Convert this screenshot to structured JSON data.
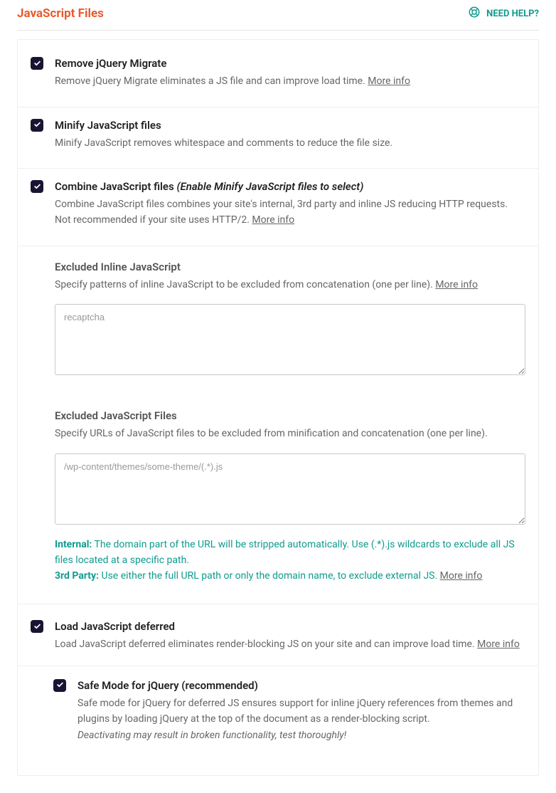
{
  "header": {
    "title": "JavaScript Files",
    "help_label": "NEED HELP?"
  },
  "options": {
    "remove_migrate": {
      "title": "Remove jQuery Migrate",
      "desc": "Remove jQuery Migrate eliminates a JS file and can improve load time. ",
      "more": "More info"
    },
    "minify": {
      "title": "Minify JavaScript files",
      "desc": "Minify JavaScript removes whitespace and comments to reduce the file size."
    },
    "combine": {
      "title": "Combine JavaScript files ",
      "hint": "(Enable Minify JavaScript files to select)",
      "desc": "Combine JavaScript files combines your site's internal, 3rd party and inline JS reducing HTTP requests. Not recommended if your site uses HTTP/2. ",
      "more": "More info"
    },
    "excluded_inline": {
      "title": "Excluded Inline JavaScript",
      "desc": "Specify patterns of inline JavaScript to be excluded from concatenation (one per line). ",
      "more": "More info",
      "placeholder": "recaptcha"
    },
    "excluded_files": {
      "title": "Excluded JavaScript Files",
      "desc": "Specify URLs of JavaScript files to be excluded from minification and concatenation (one per line).",
      "placeholder": "/wp-content/themes/some-theme/(.*).js",
      "note_internal_label": "Internal:",
      "note_internal_text": " The domain part of the URL will be stripped automatically. Use (.*).js wildcards to exclude all JS files located at a specific path.",
      "note_3rd_label": "3rd Party:",
      "note_3rd_text": " Use either the full URL path or only the domain name, to exclude external JS. ",
      "more": "More info"
    },
    "deferred": {
      "title": "Load JavaScript deferred",
      "desc": "Load JavaScript deferred eliminates render-blocking JS on your site and can improve load time. ",
      "more": "More info"
    },
    "safe_mode": {
      "title": "Safe Mode for jQuery (recommended)",
      "desc": "Safe mode for jQuery for deferred JS ensures support for inline jQuery references from themes and plugins by loading jQuery at the top of the document as a render-blocking script.",
      "warn": "Deactivating may result in broken functionality, test thoroughly!"
    }
  }
}
